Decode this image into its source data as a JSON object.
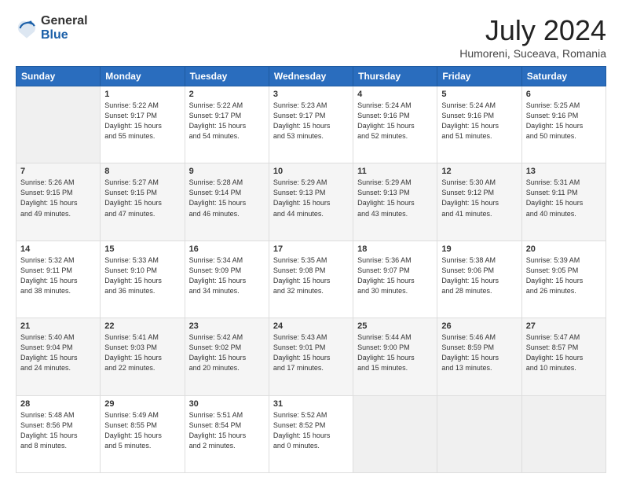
{
  "logo": {
    "general": "General",
    "blue": "Blue"
  },
  "title": "July 2024",
  "subtitle": "Humoreni, Suceava, Romania",
  "days_of_week": [
    "Sunday",
    "Monday",
    "Tuesday",
    "Wednesday",
    "Thursday",
    "Friday",
    "Saturday"
  ],
  "weeks": [
    [
      {
        "day": "",
        "content": ""
      },
      {
        "day": "1",
        "content": "Sunrise: 5:22 AM\nSunset: 9:17 PM\nDaylight: 15 hours\nand 55 minutes."
      },
      {
        "day": "2",
        "content": "Sunrise: 5:22 AM\nSunset: 9:17 PM\nDaylight: 15 hours\nand 54 minutes."
      },
      {
        "day": "3",
        "content": "Sunrise: 5:23 AM\nSunset: 9:17 PM\nDaylight: 15 hours\nand 53 minutes."
      },
      {
        "day": "4",
        "content": "Sunrise: 5:24 AM\nSunset: 9:16 PM\nDaylight: 15 hours\nand 52 minutes."
      },
      {
        "day": "5",
        "content": "Sunrise: 5:24 AM\nSunset: 9:16 PM\nDaylight: 15 hours\nand 51 minutes."
      },
      {
        "day": "6",
        "content": "Sunrise: 5:25 AM\nSunset: 9:16 PM\nDaylight: 15 hours\nand 50 minutes."
      }
    ],
    [
      {
        "day": "7",
        "content": "Sunrise: 5:26 AM\nSunset: 9:15 PM\nDaylight: 15 hours\nand 49 minutes."
      },
      {
        "day": "8",
        "content": "Sunrise: 5:27 AM\nSunset: 9:15 PM\nDaylight: 15 hours\nand 47 minutes."
      },
      {
        "day": "9",
        "content": "Sunrise: 5:28 AM\nSunset: 9:14 PM\nDaylight: 15 hours\nand 46 minutes."
      },
      {
        "day": "10",
        "content": "Sunrise: 5:29 AM\nSunset: 9:13 PM\nDaylight: 15 hours\nand 44 minutes."
      },
      {
        "day": "11",
        "content": "Sunrise: 5:29 AM\nSunset: 9:13 PM\nDaylight: 15 hours\nand 43 minutes."
      },
      {
        "day": "12",
        "content": "Sunrise: 5:30 AM\nSunset: 9:12 PM\nDaylight: 15 hours\nand 41 minutes."
      },
      {
        "day": "13",
        "content": "Sunrise: 5:31 AM\nSunset: 9:11 PM\nDaylight: 15 hours\nand 40 minutes."
      }
    ],
    [
      {
        "day": "14",
        "content": "Sunrise: 5:32 AM\nSunset: 9:11 PM\nDaylight: 15 hours\nand 38 minutes."
      },
      {
        "day": "15",
        "content": "Sunrise: 5:33 AM\nSunset: 9:10 PM\nDaylight: 15 hours\nand 36 minutes."
      },
      {
        "day": "16",
        "content": "Sunrise: 5:34 AM\nSunset: 9:09 PM\nDaylight: 15 hours\nand 34 minutes."
      },
      {
        "day": "17",
        "content": "Sunrise: 5:35 AM\nSunset: 9:08 PM\nDaylight: 15 hours\nand 32 minutes."
      },
      {
        "day": "18",
        "content": "Sunrise: 5:36 AM\nSunset: 9:07 PM\nDaylight: 15 hours\nand 30 minutes."
      },
      {
        "day": "19",
        "content": "Sunrise: 5:38 AM\nSunset: 9:06 PM\nDaylight: 15 hours\nand 28 minutes."
      },
      {
        "day": "20",
        "content": "Sunrise: 5:39 AM\nSunset: 9:05 PM\nDaylight: 15 hours\nand 26 minutes."
      }
    ],
    [
      {
        "day": "21",
        "content": "Sunrise: 5:40 AM\nSunset: 9:04 PM\nDaylight: 15 hours\nand 24 minutes."
      },
      {
        "day": "22",
        "content": "Sunrise: 5:41 AM\nSunset: 9:03 PM\nDaylight: 15 hours\nand 22 minutes."
      },
      {
        "day": "23",
        "content": "Sunrise: 5:42 AM\nSunset: 9:02 PM\nDaylight: 15 hours\nand 20 minutes."
      },
      {
        "day": "24",
        "content": "Sunrise: 5:43 AM\nSunset: 9:01 PM\nDaylight: 15 hours\nand 17 minutes."
      },
      {
        "day": "25",
        "content": "Sunrise: 5:44 AM\nSunset: 9:00 PM\nDaylight: 15 hours\nand 15 minutes."
      },
      {
        "day": "26",
        "content": "Sunrise: 5:46 AM\nSunset: 8:59 PM\nDaylight: 15 hours\nand 13 minutes."
      },
      {
        "day": "27",
        "content": "Sunrise: 5:47 AM\nSunset: 8:57 PM\nDaylight: 15 hours\nand 10 minutes."
      }
    ],
    [
      {
        "day": "28",
        "content": "Sunrise: 5:48 AM\nSunset: 8:56 PM\nDaylight: 15 hours\nand 8 minutes."
      },
      {
        "day": "29",
        "content": "Sunrise: 5:49 AM\nSunset: 8:55 PM\nDaylight: 15 hours\nand 5 minutes."
      },
      {
        "day": "30",
        "content": "Sunrise: 5:51 AM\nSunset: 8:54 PM\nDaylight: 15 hours\nand 2 minutes."
      },
      {
        "day": "31",
        "content": "Sunrise: 5:52 AM\nSunset: 8:52 PM\nDaylight: 15 hours\nand 0 minutes."
      },
      {
        "day": "",
        "content": ""
      },
      {
        "day": "",
        "content": ""
      },
      {
        "day": "",
        "content": ""
      }
    ]
  ]
}
